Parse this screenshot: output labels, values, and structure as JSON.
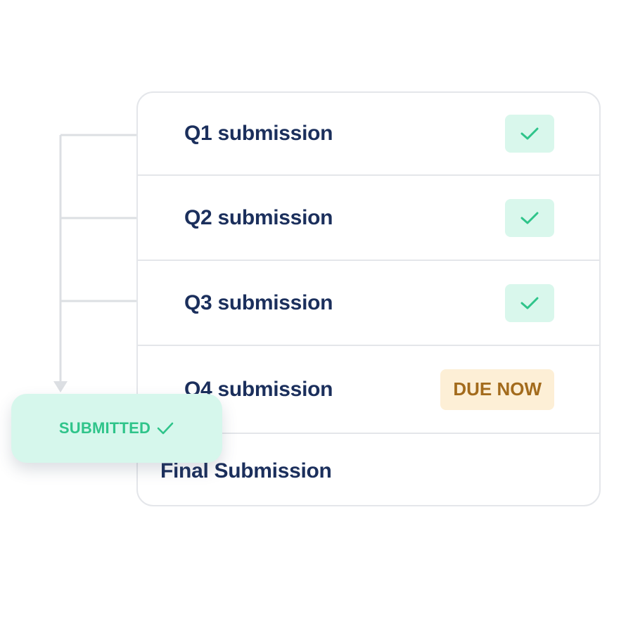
{
  "submissions": {
    "rows": [
      {
        "label": "Q1 submission",
        "status": "complete",
        "status_icon": "checkmark-icon"
      },
      {
        "label": "Q2 submission",
        "status": "complete",
        "status_icon": "checkmark-icon"
      },
      {
        "label": "Q3 submission",
        "status": "complete",
        "status_icon": "checkmark-icon"
      },
      {
        "label": "Q4 submission",
        "status": "due",
        "badge_text": "DUE NOW"
      },
      {
        "label": "Final Submission",
        "status": "none"
      }
    ]
  },
  "submitted_badge": {
    "text": "SUBMITTED",
    "icon": "checkmark-icon"
  },
  "colors": {
    "label_text": "#1b2f5c",
    "check_green": "#2fc48a",
    "check_badge_bg": "#d9f7ec",
    "due_badge_bg": "#fdefd6",
    "due_badge_text": "#a36b1c",
    "submitted_bg": "#d6f7ec",
    "divider": "#e4e6ea",
    "connector_line": "#dcdfe3"
  }
}
